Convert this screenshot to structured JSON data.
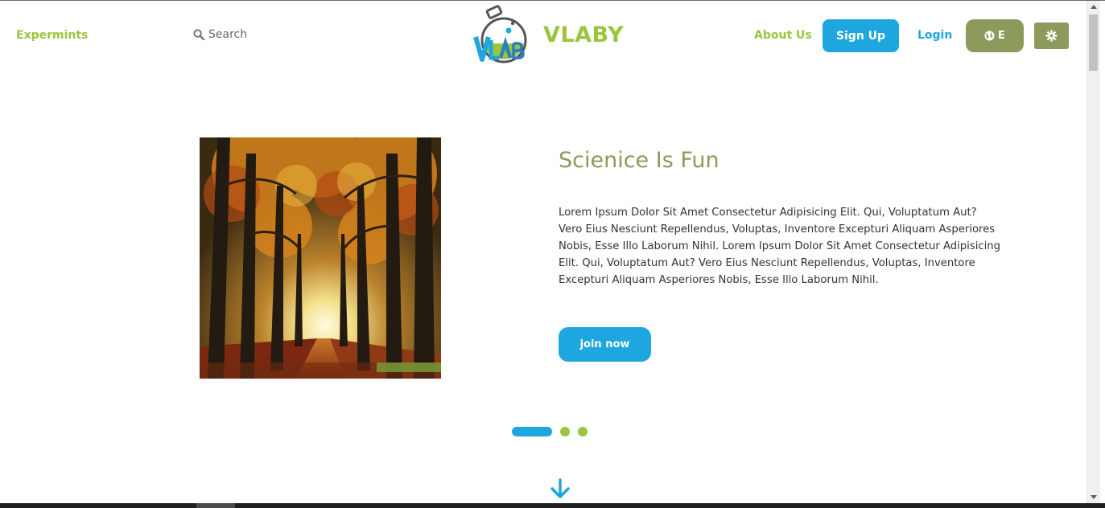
{
  "header": {
    "experiments_label": "Expermints",
    "search_placeholder": "Search",
    "brand_name": "VLABY",
    "about_label": "About Us",
    "signup_label": "Sign Up",
    "login_label": "Login",
    "language_label": "E",
    "language_icon": "globe-icon",
    "theme_icon": "gear-icon"
  },
  "hero": {
    "title": "Scienice Is Fun",
    "body": "Lorem Ipsum Dolor Sit Amet Consectetur Adipisicing Elit. Qui, Voluptatum Aut? Vero Eius Nesciunt Repellendus, Voluptas, Inventore Excepturi Aliquam Asperiores Nobis, Esse Illo Laborum Nihil. Lorem Ipsum Dolor Sit Amet Consectetur Adipisicing Elit. Qui, Voluptatum Aut? Vero Eius Nesciunt Repellendus, Voluptas, Inventore Excepturi Aliquam Asperiores Nobis, Esse Illo Laborum Nihil.",
    "cta_label": "join now",
    "image": "autumn-forest-path-photo"
  },
  "carousel": {
    "slide_count": 3,
    "active_index": 0
  },
  "colors": {
    "brand_green": "#9bc53d",
    "olive": "#8c9a5b",
    "accent_blue": "#1ea7de"
  }
}
